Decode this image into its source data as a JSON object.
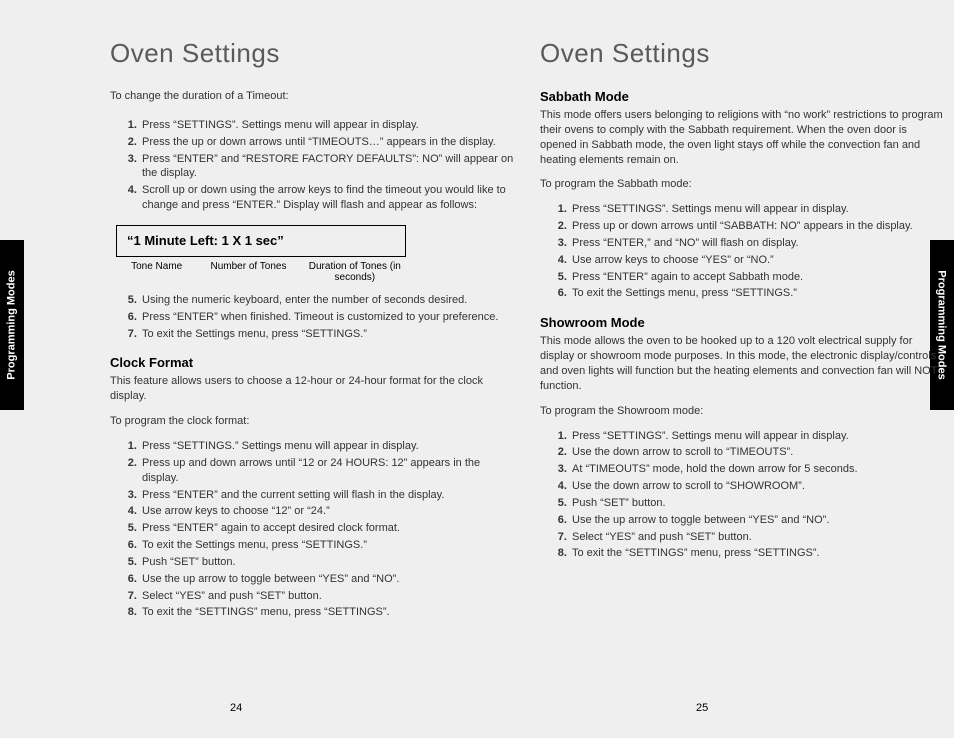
{
  "sideTab": "Programming Modes",
  "pageNumbers": {
    "left": "24",
    "right": "25"
  },
  "left": {
    "title": "Oven Settings",
    "intro": "To change the duration of a Timeout:",
    "stepsA": [
      "Press “SETTINGS”. Settings menu will appear in display.",
      "Press the up or down arrows until “TIMEOUTS…” appears in the display.",
      "Press “ENTER” and “RESTORE FACTORY DEFAULTS”: NO” will appear on the display.",
      "Scroll up or down using the arrow keys to find the timeout you would like to change and press “ENTER.” Display will flash and appear as follows:"
    ],
    "box": "“1 Minute Left: 1 X 1 sec”",
    "labels": {
      "a": "Tone Name",
      "b": "Number of Tones",
      "c": "Duration of Tones (in seconds)"
    },
    "stepsB": [
      "Using the numeric keyboard, enter the number of seconds desired.",
      "Press “ENTER” when finished. Timeout is customized to your preference.",
      "To exit the Settings menu, press “SETTINGS.”"
    ],
    "clock": {
      "heading": "Clock Format",
      "desc": "This feature allows users to choose a 12-hour or 24-hour format for the clock display.",
      "lead": "To program the clock format:",
      "steps": [
        "Press “SETTINGS.” Settings menu will appear in display.",
        "Press up and down arrows until “12 or 24 HOURS: 12” appears in the display.",
        "Press “ENTER” and the current setting will flash in the display.",
        "Use arrow keys to choose “12” or “24.”",
        "Press “ENTER” again to accept desired clock format.",
        "To exit the Settings menu, press “SETTINGS.”",
        "Push “SET” button.",
        "Use the up arrow to toggle between “YES” and “NO”.",
        "Select “YES” and push “SET” button.",
        "To exit the “SETTINGS” menu, press “SETTINGS”."
      ]
    }
  },
  "right": {
    "title": "Oven Settings",
    "sabbath": {
      "heading": "Sabbath Mode",
      "desc": "This mode offers users belonging to religions with “no work” restrictions to program their ovens to comply with the Sabbath requirement. When the oven door is opened in Sabbath mode, the oven light stays off while the convection fan and heating elements remain on.",
      "lead": "To program the Sabbath mode:",
      "steps": [
        "Press “SETTINGS”. Settings menu will appear in display.",
        "Press up or down arrows until  “SABBATH: NO” appears in the display.",
        "Press “ENTER,” and “NO” will flash on display.",
        "Use arrow keys to choose “YES” or “NO.”",
        "Press “ENTER” again to accept Sabbath mode.",
        "To exit the Settings menu, press “SETTINGS.”"
      ]
    },
    "showroom": {
      "heading": "Showroom Mode",
      "desc": "This mode allows the oven to be hooked up to a 120 volt electrical supply for display or showroom mode purposes. In this mode, the electronic display/controls and oven lights will function but the heating elements and convection fan will NOT function.",
      "lead": "To program the Showroom mode:",
      "steps": [
        "Press “SETTINGS”. Settings menu will appear in display.",
        "Use the down arrow to scroll to “TIMEOUTS”.",
        "At “TIMEOUTS” mode, hold the down arrow for 5 seconds.",
        "Use the down arrow to scroll to “SHOWROOM”.",
        "Push “SET” button.",
        "Use the up arrow to toggle between “YES” and “NO”.",
        "Select “YES” and push “SET” button.",
        "To exit the “SETTINGS” menu, press “SETTINGS”."
      ]
    }
  }
}
